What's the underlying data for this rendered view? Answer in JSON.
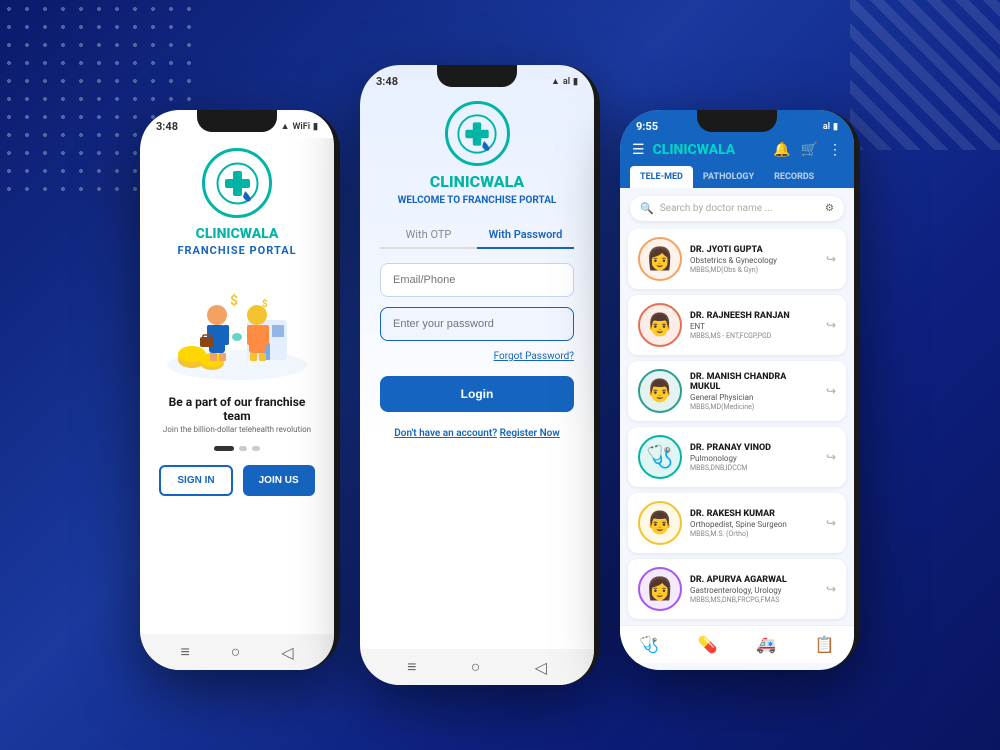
{
  "background": {
    "color1": "#0a1a6b",
    "color2": "#1a3a9f"
  },
  "phone1": {
    "status_time": "3:48",
    "status_icons": "signal wifi battery",
    "logo_text_dark": "CLINIC",
    "logo_text_teal": "WALA",
    "franchise_label": "FRANCHISE PORTAL",
    "tagline": "Be a part of our franchise team",
    "sub_tagline": "Join the billion-dollar telehealth revolution",
    "signin_label": "SIGN IN",
    "join_label": "JOIN US"
  },
  "phone2": {
    "status_time": "3:48",
    "logo_text_dark": "CLINIC",
    "logo_text_teal": "WALA",
    "welcome_prefix": "WELCOME TO ",
    "welcome_highlight": "FRANCHISE PORTAL",
    "tab_otp": "With OTP",
    "tab_password": "With Password",
    "email_placeholder": "Email/Phone",
    "password_placeholder": "Enter your password",
    "forgot_label": "Forgot Password?",
    "login_label": "Login",
    "no_account_text": "Don't have an account?",
    "register_label": "Register Now"
  },
  "phone3": {
    "status_time": "9:55",
    "logo_text_dark": "CLINIC",
    "logo_text_teal": "WALA",
    "tab_telemed": "TELE-MED",
    "tab_pathology": "PATHOLOGY",
    "tab_records": "RECORDS",
    "search_placeholder": "Search by doctor name ...",
    "doctors": [
      {
        "name": "DR. JYOTI GUPTA",
        "specialty": "Obstetrics & Gynecology",
        "qualification": "MBBS,MD(Obs & Gyn)",
        "avatar_color": "#f4a261",
        "avatar_emoji": "👩"
      },
      {
        "name": "DR. RAJNEESH RANJAN",
        "specialty": "ENT",
        "qualification": "MBBS,MS - ENT,FCGP,PGD",
        "avatar_color": "#e76f51",
        "avatar_emoji": "👨"
      },
      {
        "name": "DR. MANISH CHANDRA MUKUL",
        "specialty": "General Physician",
        "qualification": "MBBS,MD(Medicine)",
        "avatar_color": "#2a9d8f",
        "avatar_emoji": "👨"
      },
      {
        "name": "DR. PRANAY VINOD",
        "specialty": "Pulmonology",
        "qualification": "MBBS,DNB,IDCCM",
        "avatar_color": "#00b5a5",
        "avatar_emoji": "🩺"
      },
      {
        "name": "DR. RAKESH KUMAR",
        "specialty": "Orthopedist, Spine Surgeon",
        "qualification": "MBBS,M.S. (Ortho)",
        "avatar_color": "#f4c430",
        "avatar_emoji": "👨"
      },
      {
        "name": "DR. APURVA AGARWAL",
        "specialty": "Gastroenterology, Urology",
        "qualification": "MBBS,MS,DNB,FRCPG,FMAS",
        "avatar_color": "#a855f7",
        "avatar_emoji": "👩"
      }
    ]
  }
}
